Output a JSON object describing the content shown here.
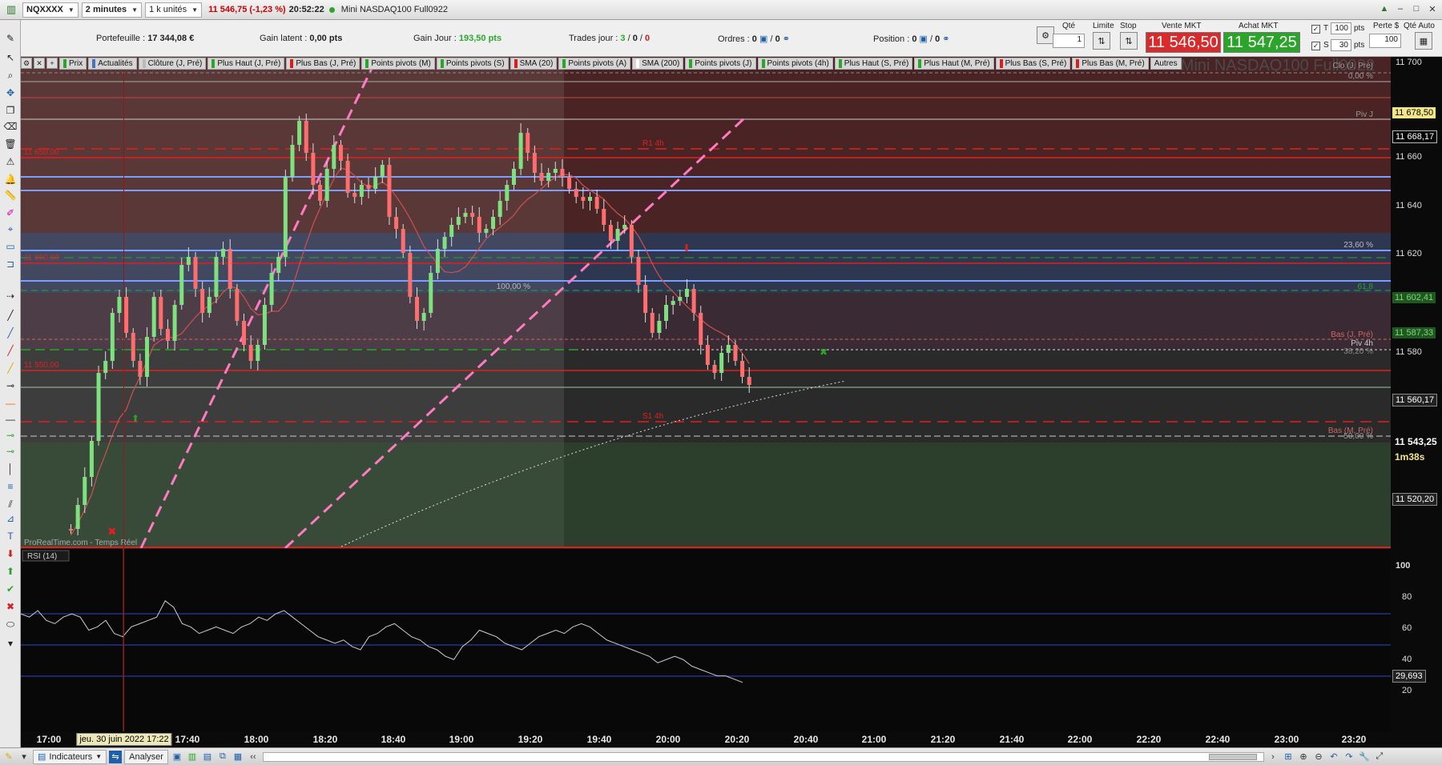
{
  "topbar": {
    "instrument": "NQXXXX",
    "timeframe": "2 minutes",
    "units": "1 k unités",
    "price": "11 546,75",
    "change": "(-1,23 %)",
    "time": "20:52:22",
    "name": "Mini NASDAQ100 Full0922"
  },
  "info": {
    "portefeuille_label": "Portefeuille :",
    "portefeuille_value": "17 344,08 €",
    "gain_latent_label": "Gain latent :",
    "gain_latent_value": "0,00 pts",
    "gain_jour_label": "Gain Jour :",
    "gain_jour_value": "193,50 pts",
    "trades_label": "Trades jour :",
    "trades_a": "3",
    "trades_b": "0",
    "trades_c": "0",
    "ordres_label": "Ordres :",
    "ordres_a": "0",
    "ordres_b": "0",
    "position_label": "Position :",
    "position_a": "0",
    "position_b": "0"
  },
  "order": {
    "qte_label": "Qté",
    "qte_value": "1",
    "limite_label": "Limite",
    "stop_label": "Stop",
    "vente_label": "Vente MKT",
    "vente_price": "11 546,50",
    "achat_label": "Achat MKT",
    "achat_price": "11 547,25",
    "t_label": "T",
    "t_value": "100",
    "s_label": "S",
    "s_value": "30",
    "pts": "pts",
    "perte_label": "Perte $",
    "perte_value": "100",
    "qte_auto_label": "Qté Auto"
  },
  "legend": [
    {
      "label": "Prix",
      "color": "#2aa52a"
    },
    {
      "label": "Actualités",
      "color": "#4472c4"
    },
    {
      "label": "Clôture (J, Pré)",
      "color": "#bbbbbb"
    },
    {
      "label": "Plus Haut (J, Pré)",
      "color": "#2aa52a"
    },
    {
      "label": "Plus Bas (J, Pré)",
      "color": "#d42020"
    },
    {
      "label": "Points pivots (M)",
      "color": "#2aa52a"
    },
    {
      "label": "Points pivots (S)",
      "color": "#2aa52a"
    },
    {
      "label": "SMA (20)",
      "color": "#d42020"
    },
    {
      "label": "Points pivots (A)",
      "color": "#2aa52a"
    },
    {
      "label": "SMA (200)",
      "color": "#ffffff"
    },
    {
      "label": "Points pivots (J)",
      "color": "#2aa52a"
    },
    {
      "label": "Points pivots (4h)",
      "color": "#2aa52a"
    },
    {
      "label": "Plus Haut (S, Pré)",
      "color": "#2aa52a"
    },
    {
      "label": "Plus Haut (M, Pré)",
      "color": "#2aa52a"
    },
    {
      "label": "Plus Bas (S, Pré)",
      "color": "#d42020"
    },
    {
      "label": "Plus Bas (M, Pré)",
      "color": "#d42020"
    },
    {
      "label": "Autres",
      "color": ""
    }
  ],
  "chart_watermark": "Mini NASDAQ100 Full0922",
  "chart_footer": "ProRealTime.com - Temps Réel",
  "rsi_label": "RSI (14)",
  "annotations": {
    "clo": "Clo (J, Pré)",
    "pct0": "0,00 %",
    "pivj": "Piv J",
    "pct236": "23,60 %",
    "pct618": "61,8",
    "basj": "Bas (J, Pré)",
    "piv4h": "Piv 4h",
    "pct382": "38,20 %",
    "basm": "Bas (M, Pré)",
    "pct50": "50,00 %",
    "pct00b": "100,00 %",
    "lvl11650": "11 650,00",
    "lvl11600": "11 600,00",
    "lvl11550": "11 550,00",
    "r4h": "R1 4h",
    "s4h": "S1 4h"
  },
  "price_axis": {
    "ticks": [
      "11 700",
      "11 660",
      "11 640",
      "11 620",
      "11 580",
      "11 560"
    ],
    "tags": {
      "p1": "11 678,50",
      "p2": "11 668,17",
      "p3": "11 602,41",
      "p4": "11 587,33",
      "p5": "11 560,17",
      "p6": "11 543,25",
      "p7": "1m38s",
      "p8": "11 520,20"
    },
    "rsi_ticks": [
      "100",
      "80",
      "60",
      "40",
      "20"
    ],
    "rsi_tag": "29,693"
  },
  "time_axis": {
    "labels": [
      "17:00",
      "17:40",
      "18:00",
      "18:20",
      "18:40",
      "19:00",
      "19:20",
      "19:40",
      "20:00",
      "20:20",
      "20:40",
      "21:00",
      "21:20",
      "21:40",
      "22:00",
      "22:20",
      "22:40",
      "23:00",
      "23:20"
    ],
    "cursor": "jeu. 30 juin 2022 17:22"
  },
  "bottom": {
    "indicateurs": "Indicateurs",
    "analyser": "Analyser"
  },
  "chart_data": {
    "type": "candlestick",
    "title": "Mini NASDAQ100 Full0922",
    "ylim": [
      11500,
      11705
    ],
    "x_range": [
      "17:00",
      "23:30"
    ],
    "candles_summary": {
      "open": 11510,
      "high": 11690,
      "low": 11507,
      "last": 11546.75
    },
    "rsi": {
      "name": "RSI (14)",
      "ylim": [
        0,
        100
      ],
      "last": 29.693,
      "levels": [
        70,
        50,
        30
      ]
    }
  }
}
